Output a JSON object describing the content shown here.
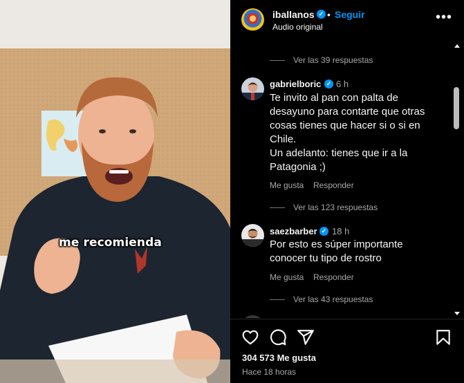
{
  "video": {
    "caption": "me recomienda"
  },
  "header": {
    "username": "iballanos",
    "separator": "•",
    "follow_label": "Seguir",
    "audio_label": "Audio original",
    "more_icon": "more-horizontal-icon"
  },
  "comments": {
    "top_replies": "Ver las 39 respuestas",
    "items": [
      {
        "username": "gabrielboric",
        "time": "6 h",
        "text": "Te invito al pan con palta de\ndesayuno para contarte que otras\ncosas tienes que hacer si o si en\nChile.\nUn adelanto: tienes que ir a la\nPatagonia ;)",
        "like_label": "Me gusta",
        "reply_label": "Responder",
        "replies": "Ver las 123 respuestas"
      },
      {
        "username": "saezbarber",
        "time": "18 h",
        "text": "Por esto es súper importante\nconocer tu tipo de rostro",
        "like_label": "Me gusta",
        "reply_label": "Responder",
        "replies": "Ver las 43 respuestas"
      }
    ]
  },
  "footer": {
    "likes": "304 573 Me gusta",
    "posted": "Hace 18 horas",
    "icons": [
      "heart-icon",
      "comment-icon",
      "share-icon",
      "bookmark-icon"
    ]
  },
  "colors": {
    "background": "#000000",
    "accent": "#0095f6",
    "muted": "#a8a8a8"
  }
}
